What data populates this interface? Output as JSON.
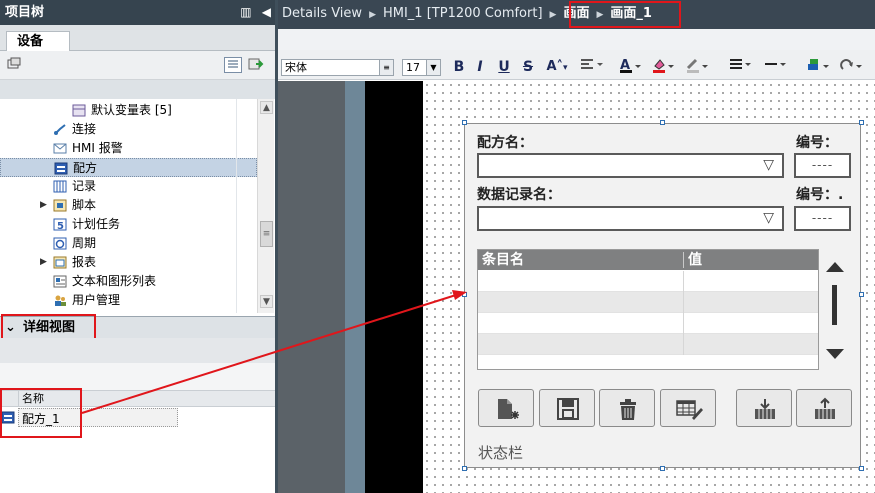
{
  "project_tree": {
    "title": "项目树",
    "tab": "设备",
    "items": [
      {
        "label": "默认变量表 [5]",
        "icon": "variable-table-icon"
      },
      {
        "label": "连接",
        "icon": "connection-icon"
      },
      {
        "label": "HMI 报警",
        "icon": "alarm-icon"
      },
      {
        "label": "配方",
        "icon": "recipe-icon"
      },
      {
        "label": "记录",
        "icon": "log-icon"
      },
      {
        "label": "脚本",
        "icon": "script-icon"
      },
      {
        "label": "计划任务",
        "icon": "scheduled-task-icon"
      },
      {
        "label": "周期",
        "icon": "cycle-icon"
      },
      {
        "label": "报表",
        "icon": "report-icon"
      },
      {
        "label": "文本和图形列表",
        "icon": "text-graphic-list-icon"
      },
      {
        "label": "用户管理",
        "icon": "user-management-icon"
      }
    ]
  },
  "details_view": {
    "title": "详细视图",
    "column_name": "名称",
    "rows": [
      {
        "name": "配方_1"
      }
    ]
  },
  "breadcrumb": {
    "items": [
      "Details View",
      "HMI_1 [TP1200 Comfort]",
      "画面",
      "画面_1"
    ]
  },
  "format_toolbar": {
    "font": "宋体",
    "size": "17",
    "buttons": [
      "B",
      "I",
      "U",
      "S",
      "A"
    ]
  },
  "recipe_view": {
    "recipe_name_label": "配方名：",
    "number_label_1": "编号：",
    "number_value_1": "----",
    "data_record_label": "数据记录名：",
    "number_label_2": "编号：.",
    "number_value_2": "----",
    "table_headers": [
      "条目名",
      "值"
    ],
    "status_bar": "状态栏"
  },
  "colors": {
    "header_bg": "#36444f",
    "highlight_red": "#e0161b",
    "selection": "#c4d3e4"
  }
}
